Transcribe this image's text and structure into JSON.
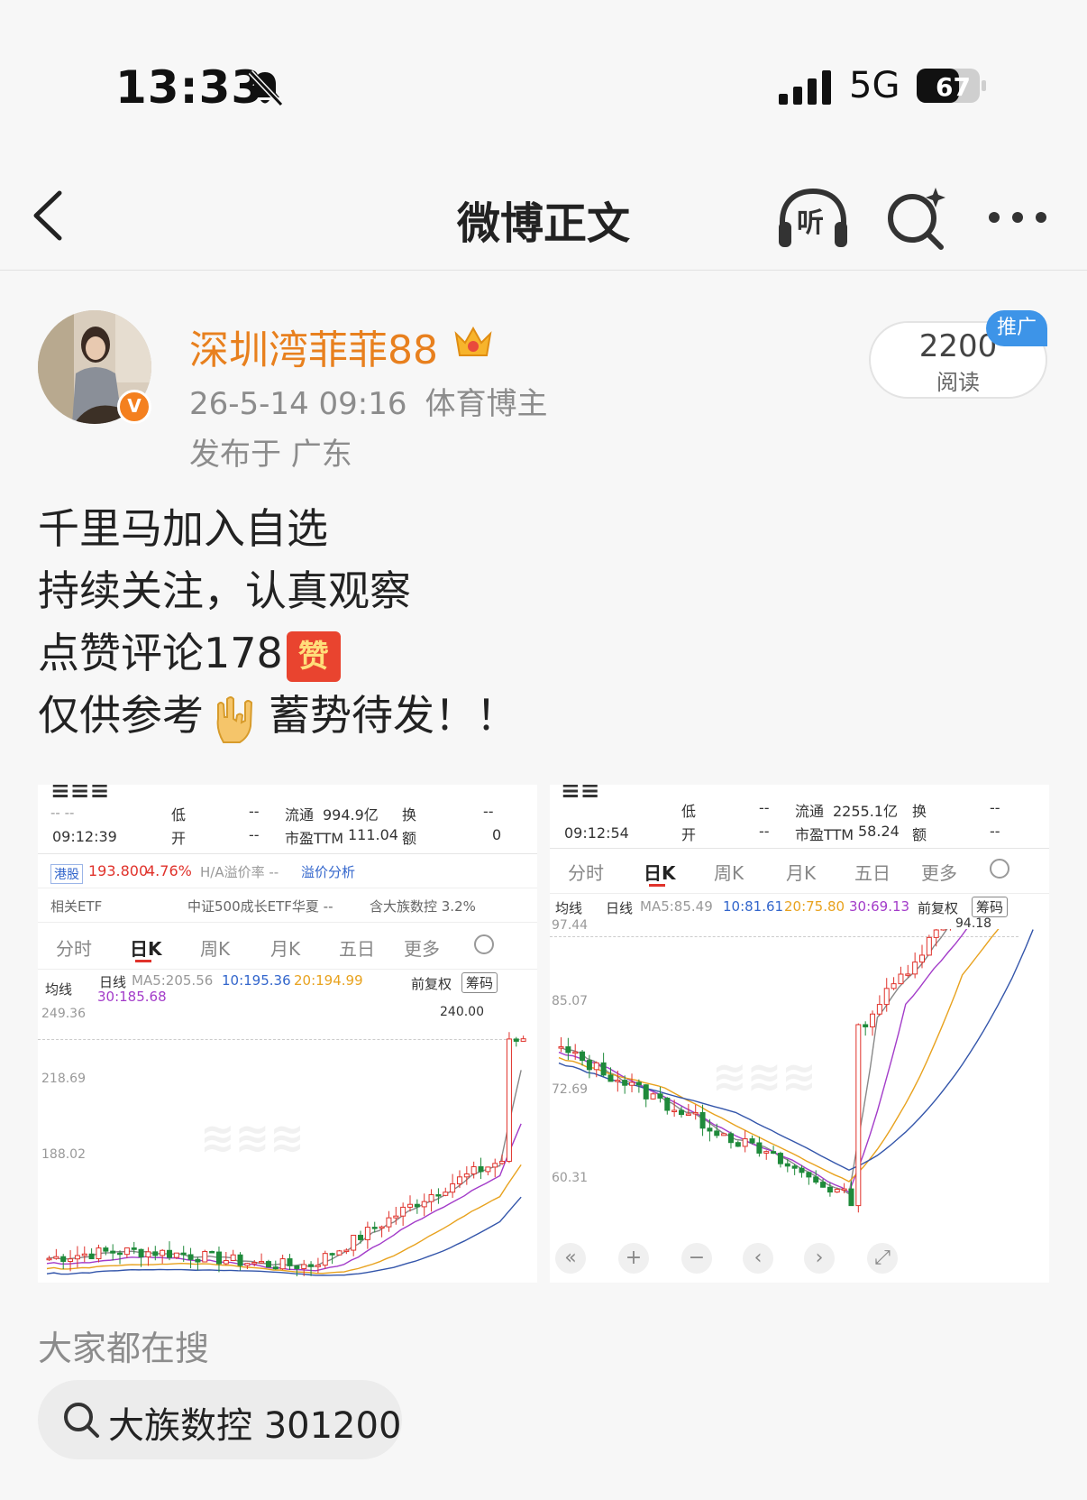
{
  "status_bar": {
    "time": "13:33",
    "network": "5G",
    "battery": "67"
  },
  "nav": {
    "title": "微博正文",
    "listen_label": "听"
  },
  "post": {
    "author": "深圳湾菲菲88",
    "timestamp": "26-5-14 09:16",
    "role": "体育博主",
    "location": "发布于 广东",
    "read_count": "2200",
    "read_label": "阅读",
    "promo_badge": "推广",
    "lines": [
      "千里马加入自选",
      "持续关注，认真观察",
      "点赞评论178",
      "仅供参考",
      "蓄势待发！！"
    ],
    "zan_sticker": "赞",
    "verified_badge": "V"
  },
  "images": {
    "left": {
      "row1": {
        "dash": "-- --",
        "low_label": "低",
        "low_val": "--",
        "float_label": "流通",
        "float_val": "994.9亿",
        "swap_label": "换",
        "swap_val": "--"
      },
      "row2": {
        "time": "09:12:39",
        "open_label": "开",
        "open_val": "--",
        "pe_label": "市盈TTM",
        "pe_val": "111.04",
        "amt_label": "额",
        "amt_val": "0"
      },
      "hk_line": {
        "tag": "港股",
        "price": "193.800",
        "pct": "4.76%",
        "ha": "H/A溢价率 --",
        "link": "溢价分析"
      },
      "etf_line": {
        "left": "相关ETF",
        "mid": "中证500成长ETF华夏 --",
        "right": "含大族数控 3.2%"
      },
      "tabs": [
        "分时",
        "日K",
        "周K",
        "月K",
        "五日",
        "更多"
      ],
      "ma_line": {
        "avg": "均线",
        "daily": "日线",
        "ma5": "MA5:205.56",
        "ma10": "10:195.36",
        "ma20": "20:194.99",
        "ma30": "30:185.68",
        "adj": "前复权",
        "chip": "筹码"
      },
      "ylabels": [
        "249.36",
        "218.69",
        "188.02"
      ],
      "peak": "240.00"
    },
    "right": {
      "row1": {
        "low_label": "低",
        "low_val": "--",
        "float_label": "流通",
        "float_val": "2255.1亿",
        "swap_label": "换",
        "swap_val": "--"
      },
      "row2": {
        "time": "09:12:54",
        "open_label": "开",
        "open_val": "--",
        "pe_label": "市盈TTM",
        "pe_val": "58.24",
        "amt_label": "额",
        "amt_val": "--"
      },
      "tabs": [
        "分时",
        "日K",
        "周K",
        "月K",
        "五日",
        "更多"
      ],
      "ma_line": {
        "avg": "均线",
        "daily": "日线",
        "ma5": "MA5:85.49",
        "ma10": "10:81.61",
        "ma20": "20:75.80",
        "ma30": "30:69.13",
        "adj": "前复权",
        "chip": "筹码"
      },
      "ylabels": [
        "97.44",
        "85.07",
        "72.69",
        "60.31"
      ],
      "peak": "94.18"
    }
  },
  "trending": {
    "title": "大家都在搜",
    "chip_label": "大族数控 301200"
  },
  "colors": {
    "accent_orange": "#e8801e",
    "candle_red": "#e0322b",
    "candle_green": "#1f8a3b",
    "promo_blue": "#3d94e8"
  },
  "icons": [
    "bell-slash-icon",
    "signal-icon",
    "battery-icon",
    "back-icon",
    "headphone-icon",
    "search-spark-icon",
    "more-icon",
    "crown-icon",
    "rock-hand-icon",
    "search-icon"
  ]
}
